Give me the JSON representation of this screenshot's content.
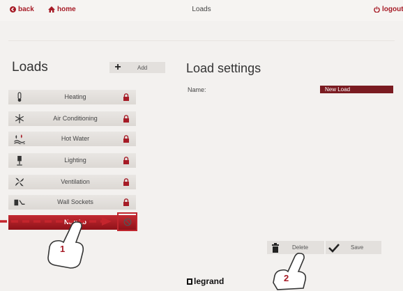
{
  "topbar": {
    "back_label": "back",
    "home_label": "home",
    "title": "Loads",
    "logout_label": "logout"
  },
  "loads_panel": {
    "title": "Loads",
    "add_label": "Add",
    "items": [
      {
        "label": "Heating",
        "icon": "thermometer-icon"
      },
      {
        "label": "Air Conditioning",
        "icon": "snowflake-icon"
      },
      {
        "label": "Hot Water",
        "icon": "hot-water-icon"
      },
      {
        "label": "Lighting",
        "icon": "lamp-icon"
      },
      {
        "label": "Ventilation",
        "icon": "fan-icon"
      },
      {
        "label": "Wall Sockets",
        "icon": "socket-icon"
      },
      {
        "label": "New Lo",
        "icon": "ban-icon",
        "selected": true
      }
    ]
  },
  "settings_panel": {
    "title": "Load settings",
    "name_label": "Name:",
    "name_value": "New Load",
    "delete_label": "Delete",
    "save_label": "Save"
  },
  "brand": "legrand",
  "callouts": {
    "step1": "1",
    "step2": "2"
  },
  "colors": {
    "accent": "#a61b26",
    "selected_row": "#b01e27",
    "name_field": "#7a1b21"
  }
}
